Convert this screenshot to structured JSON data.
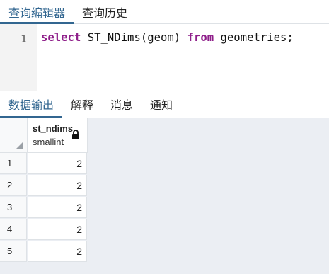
{
  "query_tabs": [
    "查询编辑器",
    "查询历史"
  ],
  "editor": {
    "line_number": "1",
    "tokens": [
      {
        "text": "select",
        "kw": true
      },
      {
        "text": " ST_NDims(geom) ",
        "kw": false
      },
      {
        "text": "from",
        "kw": true
      },
      {
        "text": " geometries;",
        "kw": false
      }
    ]
  },
  "result_tabs": [
    "数据输出",
    "解释",
    "消息",
    "通知"
  ],
  "grid": {
    "column": {
      "name": "st_ndims",
      "type": "smallint"
    },
    "rows": [
      {
        "num": "1",
        "value": "2"
      },
      {
        "num": "2",
        "value": "2"
      },
      {
        "num": "3",
        "value": "2"
      },
      {
        "num": "4",
        "value": "2"
      },
      {
        "num": "5",
        "value": "2"
      }
    ]
  },
  "colors": {
    "accent": "#326690",
    "keyword": "#8f1f8a"
  }
}
